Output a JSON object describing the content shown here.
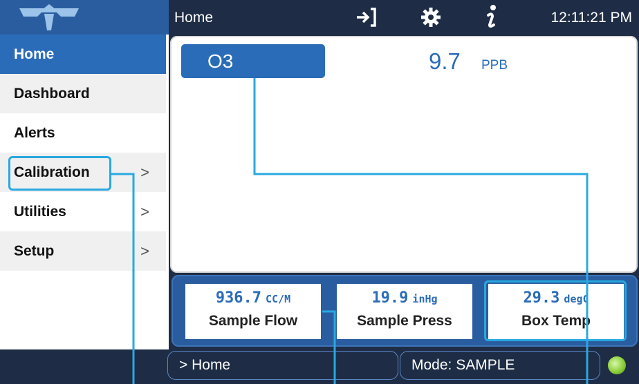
{
  "header": {
    "title": "Home",
    "time": "12:11:21 PM"
  },
  "sidebar": {
    "items": [
      {
        "label": "Home",
        "active": true
      },
      {
        "label": "Dashboard"
      },
      {
        "label": "Alerts"
      },
      {
        "label": "Calibration",
        "chevron": ">"
      },
      {
        "label": "Utilities",
        "chevron": ">"
      },
      {
        "label": "Setup",
        "chevron": ">"
      }
    ]
  },
  "main": {
    "gas_name": "O3",
    "gas_value": "9.7",
    "gas_unit": "PPB"
  },
  "readings": [
    {
      "value": "936.7",
      "unit": "CC/M",
      "label": "Sample Flow"
    },
    {
      "value": "19.9",
      "unit": "inHg",
      "label": "Sample Press"
    },
    {
      "value": "29.3",
      "unit": "degC",
      "label": "Box Temp"
    }
  ],
  "footer": {
    "breadcrumb": "> Home",
    "mode": "Mode: SAMPLE"
  },
  "icons": {
    "logo": "teledyne-logo",
    "login": "sign-in-icon",
    "settings": "gear-icon",
    "info": "info-icon",
    "status": "status-led-icon"
  },
  "colors": {
    "accent": "#2a6cb8",
    "header_bg": "#1e2d45",
    "callout": "#29a8e0",
    "status_led": "#8ccf3a"
  }
}
